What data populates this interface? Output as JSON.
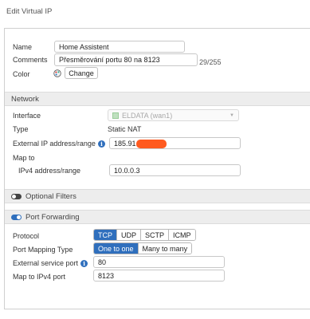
{
  "header": {
    "title": "Edit Virtual IP"
  },
  "general": {
    "name_label": "Name",
    "name_value": "Home Assistent",
    "comments_label": "Comments",
    "comments_value": "Přesměrování portu 80 na 8123",
    "comments_counter": "29/255",
    "color_label": "Color",
    "color_change": "Change"
  },
  "network": {
    "section_title": "Network",
    "interface_label": "Interface",
    "interface_value": "ELDATA (wan1)",
    "type_label": "Type",
    "type_value": "Static NAT",
    "ext_ip_label": "External IP address/range",
    "ext_ip_value": "185.91.",
    "map_to_label": "Map to",
    "ipv4_label": "IPv4 address/range",
    "ipv4_value": "10.0.0.3"
  },
  "optional_filters": {
    "section_title": "Optional Filters",
    "enabled": false
  },
  "port_forwarding": {
    "section_title": "Port Forwarding",
    "enabled": true,
    "protocol_label": "Protocol",
    "protocols": [
      "TCP",
      "UDP",
      "SCTP",
      "ICMP"
    ],
    "protocol_selected": "TCP",
    "mapping_type_label": "Port Mapping Type",
    "mapping_types": [
      "One to one",
      "Many to many"
    ],
    "mapping_selected": "One to one",
    "ext_port_label": "External service port",
    "ext_port_value": "80",
    "map_port_label": "Map to IPv4 port",
    "map_port_value": "8123"
  },
  "colors": {
    "accent": "#2f6fbd",
    "redaction": "#ff5a1f",
    "section_bg": "#ededed"
  }
}
